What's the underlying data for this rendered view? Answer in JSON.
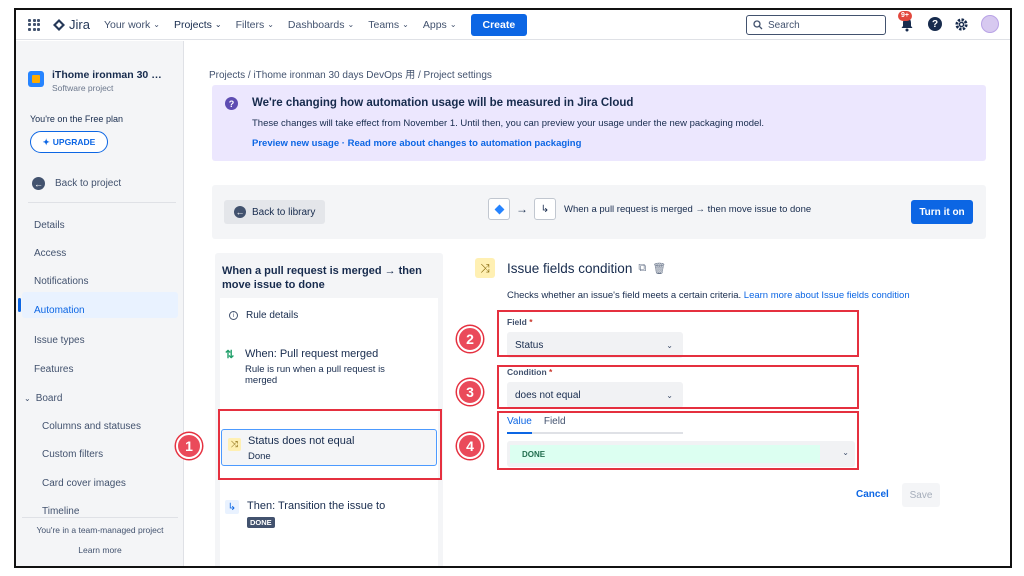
{
  "topnav": {
    "app_name": "Jira",
    "items": [
      "Your work",
      "Projects",
      "Filters",
      "Dashboards",
      "Teams",
      "Apps"
    ],
    "chevron": "⌄",
    "create_label": "Create",
    "search_placeholder": "Search",
    "notification_badge": "9+",
    "help_glyph": "?"
  },
  "sidebar": {
    "project_name": "iThome ironman 30 da...",
    "project_type": "Software project",
    "plan_text": "You're on the Free plan",
    "upgrade_label": "UPGRADE",
    "back_label": "Back to project",
    "items": [
      "Details",
      "Access",
      "Notifications",
      "Automation",
      "Issue types",
      "Features",
      "Board",
      "Columns and statuses",
      "Custom filters",
      "Card cover images",
      "Timeline"
    ],
    "active_item": "Automation",
    "team_msg": "You're in a team-managed project",
    "learn_more": "Learn more"
  },
  "breadcrumb": "Projects  /  iThome ironman 30 days DevOps 用  /  Project settings",
  "banner": {
    "icon_glyph": "?",
    "title": "We're changing how automation usage will be measured in Jira Cloud",
    "text": "These changes will take effect from November 1. Until then, you can preview your usage under the new packaging model.",
    "link1": "Preview new usage",
    "separator": " · ",
    "link2": "Read more about changes to automation packaging"
  },
  "builder": {
    "back_label": "Back to library",
    "flow_text": "When a pull request is merged → then move issue to done",
    "turn_on_label": "Turn it on"
  },
  "rule": {
    "title": "When a pull request is merged → then move issue to done",
    "details_label": "Rule details",
    "trigger_title": "When: Pull request merged",
    "trigger_sub": "Rule is run when a pull request is merged",
    "condition_title": "Status does not equal",
    "condition_sub": "Done",
    "action_title": "Then: Transition the issue to",
    "action_status": "DONE"
  },
  "editor": {
    "title": "Issue fields condition",
    "desc": "Checks whether an issue's field meets a certain criteria.",
    "desc_link": "Learn more about Issue fields condition",
    "field_label": "Field",
    "required_mark": "*",
    "field_value": "Status",
    "condition_label": "Condition",
    "condition_value": "does not equal",
    "tab_value": "Value",
    "tab_field": "Field",
    "value": "DONE",
    "cancel_label": "Cancel",
    "save_label": "Save"
  },
  "annotations": [
    "1",
    "2",
    "3",
    "4"
  ],
  "colors": {
    "primary": "#0c66e4",
    "annotation_red": "#e5303f"
  }
}
